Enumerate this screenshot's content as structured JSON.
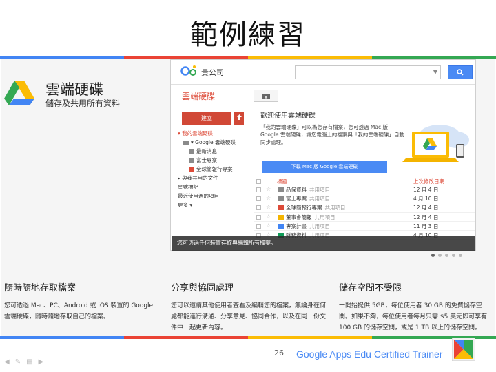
{
  "slide": {
    "title": "範例練習",
    "page_number": "26"
  },
  "brand_colors": [
    "#4285f4",
    "#ea4335",
    "#fbbc05",
    "#34a853"
  ],
  "drive": {
    "title": "雲端硬碟",
    "subtitle": "儲存及共用所有資料"
  },
  "window": {
    "org_name": "貴公司",
    "search_placeholder": "",
    "drive_heading": "雲端硬碟",
    "create_label": "建立",
    "nav": [
      {
        "label": "▾ 我的雲端硬碟",
        "active": true,
        "level": 0,
        "icon": ""
      },
      {
        "label": "▾ Google 雲端硬碟",
        "active": false,
        "level": 1,
        "icon": "folder-gray"
      },
      {
        "label": "最新消息",
        "active": false,
        "level": 2,
        "icon": "folder-gray"
      },
      {
        "label": "富士專案",
        "active": false,
        "level": 2,
        "icon": "folder-gray"
      },
      {
        "label": "全球簡報行專案",
        "active": false,
        "level": 2,
        "icon": "folder-red"
      },
      {
        "label": "▸ 與我共用的文件",
        "active": false,
        "level": 0,
        "icon": ""
      },
      {
        "label": "星號標記",
        "active": false,
        "level": 0,
        "icon": ""
      },
      {
        "label": "最近使用過的項目",
        "active": false,
        "level": 0,
        "icon": ""
      },
      {
        "label": "更多 ▾",
        "active": false,
        "level": 0,
        "icon": ""
      }
    ],
    "welcome_title": "歡迎使用雲端硬碟",
    "welcome_body": "「我的雲端硬碟」可以為您存有檔案，您可透過 Mac 版 Google 雲端硬碟，讓您電腦上的檔案與「我的雲端硬碟」自動同步處理。",
    "download_label": "下載 Mac 版 Google 雲端硬碟",
    "table_header": {
      "name": "標題",
      "date": "上次修改日期"
    },
    "rows": [
      {
        "name": "品保資料",
        "owner": "共用項目",
        "date": "12 月 4 日",
        "icon": "folder-gray"
      },
      {
        "name": "富士專案",
        "owner": "共用項目",
        "date": "4 月 10 日",
        "icon": "folder-gray"
      },
      {
        "name": "全球簡報行專案",
        "owner": "共用項目",
        "date": "12 月 4 日",
        "icon": "folder-red"
      },
      {
        "name": "董事會簡報",
        "owner": "共用項目",
        "date": "12 月 4 日",
        "icon": "slides"
      },
      {
        "name": "專案計畫",
        "owner": "共用項目",
        "date": "11 月 3 日",
        "icon": "doc"
      },
      {
        "name": "財務資料",
        "owner": "共用項目",
        "date": "4 月 10 日",
        "icon": "sheet"
      }
    ],
    "caption": "您可透過任何裝置存取與編輯所有檔案。"
  },
  "features": [
    {
      "title": "隨時隨地存取檔案",
      "body": "您可透過 Mac、PC、Android 或 iOS 裝置的 Google 雲端硬碟，隨時隨地存取自己的檔案。"
    },
    {
      "title": "分享與協同處理",
      "body": "您可以邀請其他使用者查看及編輯您的檔案，無論身在何處都能進行溝通、分享意見、協同合作，以及在同一份文件中一起更新內容。"
    },
    {
      "title": "儲存空間不受限",
      "body": "一開始提供 5GB，每位使用者 30 GB 的免費儲存空間。如果不夠，每位使用者每月只需 $5 美元即可享有 100 GB 的儲存空間，或是 1 TB 以上的儲存空間。"
    }
  ],
  "footer": {
    "trainer": "Google Apps Edu Certified Trainer"
  }
}
